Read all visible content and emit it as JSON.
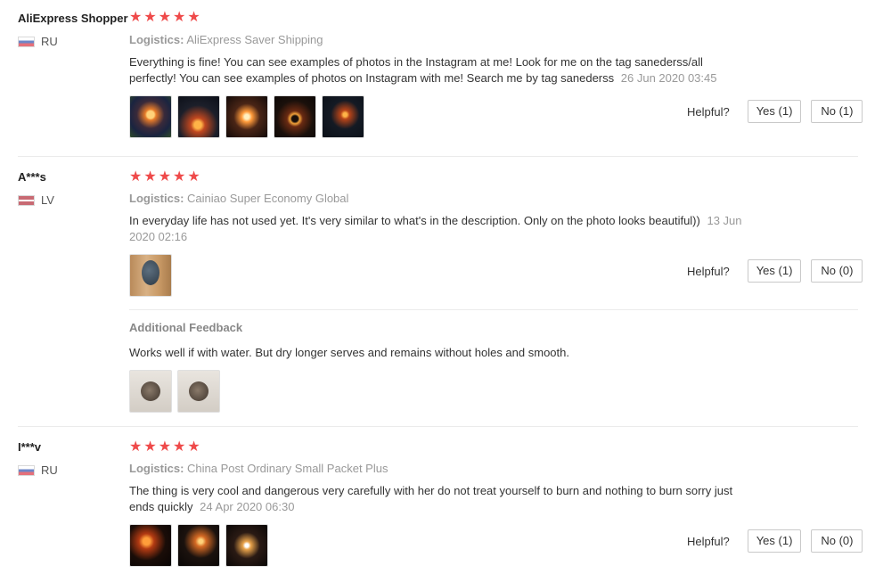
{
  "reviews": [
    {
      "user": "AliExpress Shopper",
      "country": "RU",
      "logistics_label": "Logistics:",
      "logistics_value": "AliExpress Saver Shipping",
      "text": "Everything is fine! You can see examples of photos in the Instagram at me! Look for me on the tag sanederss/all perfectly! You can see examples of photos on Instagram with me! Search me by tag sanederss",
      "date": "26 Jun 2020 03:45",
      "helpful_label": "Helpful?",
      "yes_label": "Yes (1)",
      "no_label": "No (1)"
    },
    {
      "user": "A***s",
      "country": "LV",
      "logistics_label": "Logistics:",
      "logistics_value": "Cainiao Super Economy Global",
      "text": "In everyday life has not used yet. It's very similar to what's in the description. Only on the photo looks beautiful))",
      "date": "13 Jun 2020 02:16",
      "helpful_label": "Helpful?",
      "yes_label": "Yes (1)",
      "no_label": "No (0)",
      "additional_title": "Additional Feedback",
      "additional_text": "Works well if with water. But dry longer serves and remains without holes and smooth."
    },
    {
      "user": "I***v",
      "country": "RU",
      "logistics_label": "Logistics:",
      "logistics_value": "China Post Ordinary Small Packet Plus",
      "text": "The thing is very cool and dangerous very carefully with her do not treat yourself to burn and nothing to burn sorry just ends quickly",
      "date": "24 Apr 2020 06:30",
      "helpful_label": "Helpful?",
      "yes_label": "Yes (1)",
      "no_label": "No (0)"
    }
  ],
  "colors": {
    "star": "#ef4a4a",
    "muted": "#999999"
  },
  "icons": {
    "star": "star-icon",
    "flag_ru": "flag-ru-icon",
    "flag_lv": "flag-lv-icon"
  }
}
